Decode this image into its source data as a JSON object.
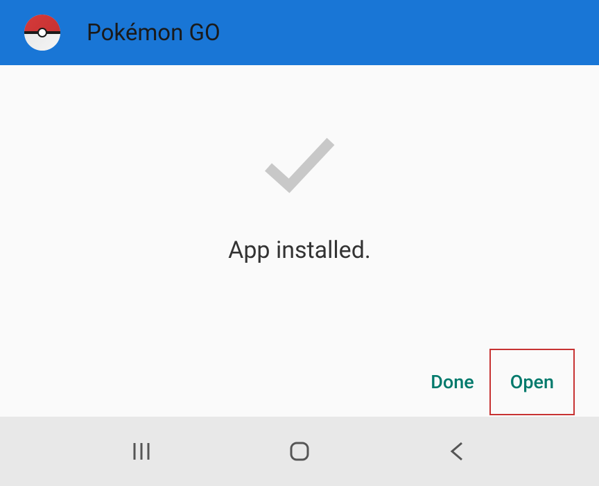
{
  "header": {
    "app_name": "Pokémon GO",
    "icon_name": "pokeball-icon"
  },
  "content": {
    "status_message": "App installed.",
    "checkmark_name": "checkmark-icon"
  },
  "buttons": {
    "done_label": "Done",
    "open_label": "Open"
  },
  "nav": {
    "recents_name": "recents-icon",
    "home_name": "home-icon",
    "back_name": "back-icon"
  },
  "colors": {
    "primary": "#1976d6",
    "accent": "#00796b",
    "highlight_border": "#c73232"
  }
}
